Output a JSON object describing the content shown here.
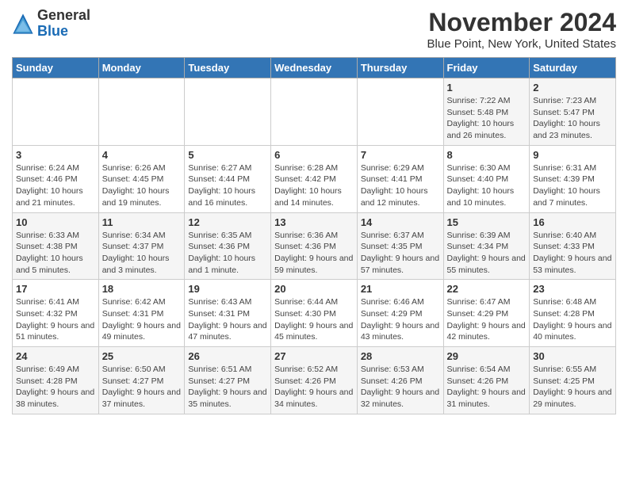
{
  "logo": {
    "general": "General",
    "blue": "Blue"
  },
  "header": {
    "month": "November 2024",
    "location": "Blue Point, New York, United States"
  },
  "weekdays": [
    "Sunday",
    "Monday",
    "Tuesday",
    "Wednesday",
    "Thursday",
    "Friday",
    "Saturday"
  ],
  "weeks": [
    [
      {
        "day": "",
        "info": ""
      },
      {
        "day": "",
        "info": ""
      },
      {
        "day": "",
        "info": ""
      },
      {
        "day": "",
        "info": ""
      },
      {
        "day": "",
        "info": ""
      },
      {
        "day": "1",
        "info": "Sunrise: 7:22 AM\nSunset: 5:48 PM\nDaylight: 10 hours and 26 minutes."
      },
      {
        "day": "2",
        "info": "Sunrise: 7:23 AM\nSunset: 5:47 PM\nDaylight: 10 hours and 23 minutes."
      }
    ],
    [
      {
        "day": "3",
        "info": "Sunrise: 6:24 AM\nSunset: 4:46 PM\nDaylight: 10 hours and 21 minutes."
      },
      {
        "day": "4",
        "info": "Sunrise: 6:26 AM\nSunset: 4:45 PM\nDaylight: 10 hours and 19 minutes."
      },
      {
        "day": "5",
        "info": "Sunrise: 6:27 AM\nSunset: 4:44 PM\nDaylight: 10 hours and 16 minutes."
      },
      {
        "day": "6",
        "info": "Sunrise: 6:28 AM\nSunset: 4:42 PM\nDaylight: 10 hours and 14 minutes."
      },
      {
        "day": "7",
        "info": "Sunrise: 6:29 AM\nSunset: 4:41 PM\nDaylight: 10 hours and 12 minutes."
      },
      {
        "day": "8",
        "info": "Sunrise: 6:30 AM\nSunset: 4:40 PM\nDaylight: 10 hours and 10 minutes."
      },
      {
        "day": "9",
        "info": "Sunrise: 6:31 AM\nSunset: 4:39 PM\nDaylight: 10 hours and 7 minutes."
      }
    ],
    [
      {
        "day": "10",
        "info": "Sunrise: 6:33 AM\nSunset: 4:38 PM\nDaylight: 10 hours and 5 minutes."
      },
      {
        "day": "11",
        "info": "Sunrise: 6:34 AM\nSunset: 4:37 PM\nDaylight: 10 hours and 3 minutes."
      },
      {
        "day": "12",
        "info": "Sunrise: 6:35 AM\nSunset: 4:36 PM\nDaylight: 10 hours and 1 minute."
      },
      {
        "day": "13",
        "info": "Sunrise: 6:36 AM\nSunset: 4:36 PM\nDaylight: 9 hours and 59 minutes."
      },
      {
        "day": "14",
        "info": "Sunrise: 6:37 AM\nSunset: 4:35 PM\nDaylight: 9 hours and 57 minutes."
      },
      {
        "day": "15",
        "info": "Sunrise: 6:39 AM\nSunset: 4:34 PM\nDaylight: 9 hours and 55 minutes."
      },
      {
        "day": "16",
        "info": "Sunrise: 6:40 AM\nSunset: 4:33 PM\nDaylight: 9 hours and 53 minutes."
      }
    ],
    [
      {
        "day": "17",
        "info": "Sunrise: 6:41 AM\nSunset: 4:32 PM\nDaylight: 9 hours and 51 minutes."
      },
      {
        "day": "18",
        "info": "Sunrise: 6:42 AM\nSunset: 4:31 PM\nDaylight: 9 hours and 49 minutes."
      },
      {
        "day": "19",
        "info": "Sunrise: 6:43 AM\nSunset: 4:31 PM\nDaylight: 9 hours and 47 minutes."
      },
      {
        "day": "20",
        "info": "Sunrise: 6:44 AM\nSunset: 4:30 PM\nDaylight: 9 hours and 45 minutes."
      },
      {
        "day": "21",
        "info": "Sunrise: 6:46 AM\nSunset: 4:29 PM\nDaylight: 9 hours and 43 minutes."
      },
      {
        "day": "22",
        "info": "Sunrise: 6:47 AM\nSunset: 4:29 PM\nDaylight: 9 hours and 42 minutes."
      },
      {
        "day": "23",
        "info": "Sunrise: 6:48 AM\nSunset: 4:28 PM\nDaylight: 9 hours and 40 minutes."
      }
    ],
    [
      {
        "day": "24",
        "info": "Sunrise: 6:49 AM\nSunset: 4:28 PM\nDaylight: 9 hours and 38 minutes."
      },
      {
        "day": "25",
        "info": "Sunrise: 6:50 AM\nSunset: 4:27 PM\nDaylight: 9 hours and 37 minutes."
      },
      {
        "day": "26",
        "info": "Sunrise: 6:51 AM\nSunset: 4:27 PM\nDaylight: 9 hours and 35 minutes."
      },
      {
        "day": "27",
        "info": "Sunrise: 6:52 AM\nSunset: 4:26 PM\nDaylight: 9 hours and 34 minutes."
      },
      {
        "day": "28",
        "info": "Sunrise: 6:53 AM\nSunset: 4:26 PM\nDaylight: 9 hours and 32 minutes."
      },
      {
        "day": "29",
        "info": "Sunrise: 6:54 AM\nSunset: 4:26 PM\nDaylight: 9 hours and 31 minutes."
      },
      {
        "day": "30",
        "info": "Sunrise: 6:55 AM\nSunset: 4:25 PM\nDaylight: 9 hours and 29 minutes."
      }
    ]
  ]
}
